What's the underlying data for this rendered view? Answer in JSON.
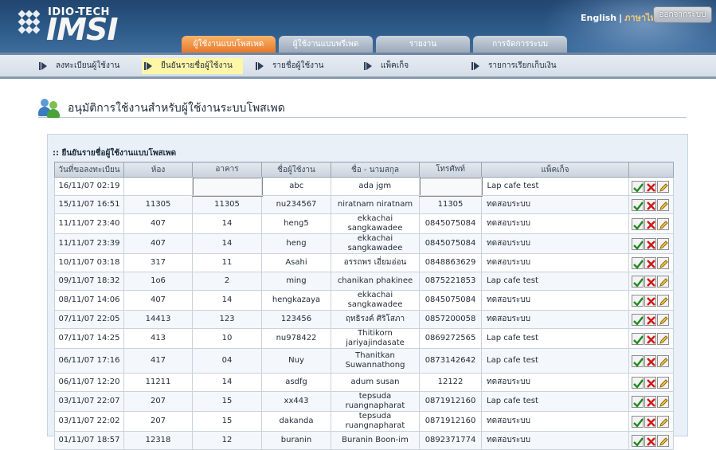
{
  "header": {
    "logo_small": "IDIO-TECH",
    "logo_big": "IMSI",
    "lang_en": "English",
    "lang_sep": "|",
    "lang_th": "ภาษาไทย",
    "logout": "ออกจากระบบ",
    "tabs": [
      {
        "label": "ผู้ใช้งานแบบโพสเพด",
        "active": true
      },
      {
        "label": "ผู้ใช้งานแบบพรีเพด",
        "active": false
      },
      {
        "label": "รายงาน",
        "active": false
      },
      {
        "label": "การจัดการระบบ",
        "active": false
      }
    ]
  },
  "submenu": [
    {
      "label": "ลงทะเบียนผู้ใช้งาน",
      "active": false
    },
    {
      "label": "ยืนยันรายชื่อผู้ใช้งาน",
      "active": true
    },
    {
      "label": "รายชื่อผู้ใช้งาน",
      "active": false
    },
    {
      "label": "แพ็คเก็จ",
      "active": false
    },
    {
      "label": "รายการเรียกเก็บเงิน",
      "active": false
    }
  ],
  "page_title": "อนุมัติการใช้งานสำหรับผู้ใช้งานระบบโพสเพด",
  "panel_title": ":: ยืนยันรายชื่อผู้ใช้งานแบบโพสเพด",
  "table": {
    "columns": [
      "วันที่ขอลงทะเบียน",
      "ห้อง",
      "อาคาร",
      "ชื่อผู้ใช้งาน",
      "ชื่อ - นามสกุล",
      "โทรศัพท์",
      "แพ็คเก็จ",
      ""
    ],
    "rows": [
      [
        "16/11/07 02:19",
        "",
        "",
        "abc",
        "ada jgm",
        "",
        "Lap cafe test"
      ],
      [
        "15/11/07 16:51",
        "11305",
        "11305",
        "nu234567",
        "niratnam niratnam",
        "11305",
        "ทดสอบระบบ"
      ],
      [
        "11/11/07 23:40",
        "407",
        "14",
        "heng5",
        "ekkachai sangkawadee",
        "0845075084",
        "ทดสอบระบบ"
      ],
      [
        "11/11/07 23:39",
        "407",
        "14",
        "heng",
        "ekkachai sangkawadee",
        "0845075084",
        "ทดสอบระบบ"
      ],
      [
        "10/11/07 03:18",
        "317",
        "11",
        "Asahi",
        "อรรถพร เอี่ยมอ่อน",
        "0848863629",
        "ทดสอบระบบ"
      ],
      [
        "09/11/07 18:32",
        "1o6",
        "2",
        "ming",
        "chanikan phakinee",
        "0875221853",
        "Lap cafe test"
      ],
      [
        "08/11/07 14:06",
        "407",
        "14",
        "hengkazaya",
        "ekkachai sangkawadee",
        "0845075084",
        "ทดสอบระบบ"
      ],
      [
        "07/11/07 22:05",
        "14413",
        "123",
        "123456",
        "ฤทธิรงค์ ศิริโสภา",
        "0857200058",
        "ทดสอบระบบ"
      ],
      [
        "07/11/07 14:25",
        "413",
        "10",
        "nu978422",
        "Thitikorn jariyajindasate",
        "0869272565",
        "Lap cafe test"
      ],
      [
        "06/11/07 17:16",
        "417",
        "04",
        "Nuy",
        "Thanitkan Suwannathong",
        "0873142642",
        "Lap cafe test"
      ],
      [
        "06/11/07 12:20",
        "11211",
        "14",
        "asdfg",
        "adum susan",
        "12122",
        "ทดสอบระบบ"
      ],
      [
        "03/11/07 22:07",
        "207",
        "15",
        "xx443",
        "tepsuda ruangnapharat",
        "0871912160",
        "Lap cafe test"
      ],
      [
        "03/11/07 22:02",
        "207",
        "15",
        "dakanda",
        "tepsuda ruangnapharat",
        "0871912160",
        "ทดสอบระบบ"
      ],
      [
        "01/11/07 18:57",
        "12318",
        "12",
        "buranin",
        "Buranin Boon-im",
        "0892371774",
        "ทดสอบระบบ"
      ]
    ],
    "actions": [
      "approve-icon",
      "reject-icon",
      "edit-icon"
    ]
  }
}
